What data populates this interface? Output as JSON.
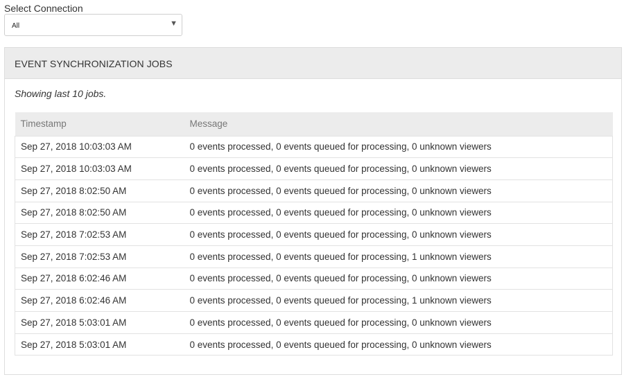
{
  "connection": {
    "label": "Select Connection",
    "selected": "All",
    "caret_icon": "chevron-down-icon"
  },
  "panel": {
    "title": "EVENT SYNCHRONIZATION JOBS",
    "showing_text": "Showing last 10 jobs."
  },
  "table": {
    "columns": [
      "Timestamp",
      "Message"
    ],
    "rows": [
      {
        "timestamp": "Sep 27, 2018 10:03:03 AM",
        "message": "0 events processed, 0 events queued for processing, 0 unknown viewers"
      },
      {
        "timestamp": "Sep 27, 2018 10:03:03 AM",
        "message": "0 events processed, 0 events queued for processing, 0 unknown viewers"
      },
      {
        "timestamp": "Sep 27, 2018 8:02:50 AM",
        "message": "0 events processed, 0 events queued for processing, 0 unknown viewers"
      },
      {
        "timestamp": "Sep 27, 2018 8:02:50 AM",
        "message": "0 events processed, 0 events queued for processing, 0 unknown viewers"
      },
      {
        "timestamp": "Sep 27, 2018 7:02:53 AM",
        "message": "0 events processed, 0 events queued for processing, 0 unknown viewers"
      },
      {
        "timestamp": "Sep 27, 2018 7:02:53 AM",
        "message": "0 events processed, 0 events queued for processing, 1 unknown viewers"
      },
      {
        "timestamp": "Sep 27, 2018 6:02:46 AM",
        "message": "0 events processed, 0 events queued for processing, 0 unknown viewers"
      },
      {
        "timestamp": "Sep 27, 2018 6:02:46 AM",
        "message": "0 events processed, 0 events queued for processing, 1 unknown viewers"
      },
      {
        "timestamp": "Sep 27, 2018 5:03:01 AM",
        "message": "0 events processed, 0 events queued for processing, 0 unknown viewers"
      },
      {
        "timestamp": "Sep 27, 2018 5:03:01 AM",
        "message": "0 events processed, 0 events queued for processing, 0 unknown viewers"
      }
    ]
  }
}
